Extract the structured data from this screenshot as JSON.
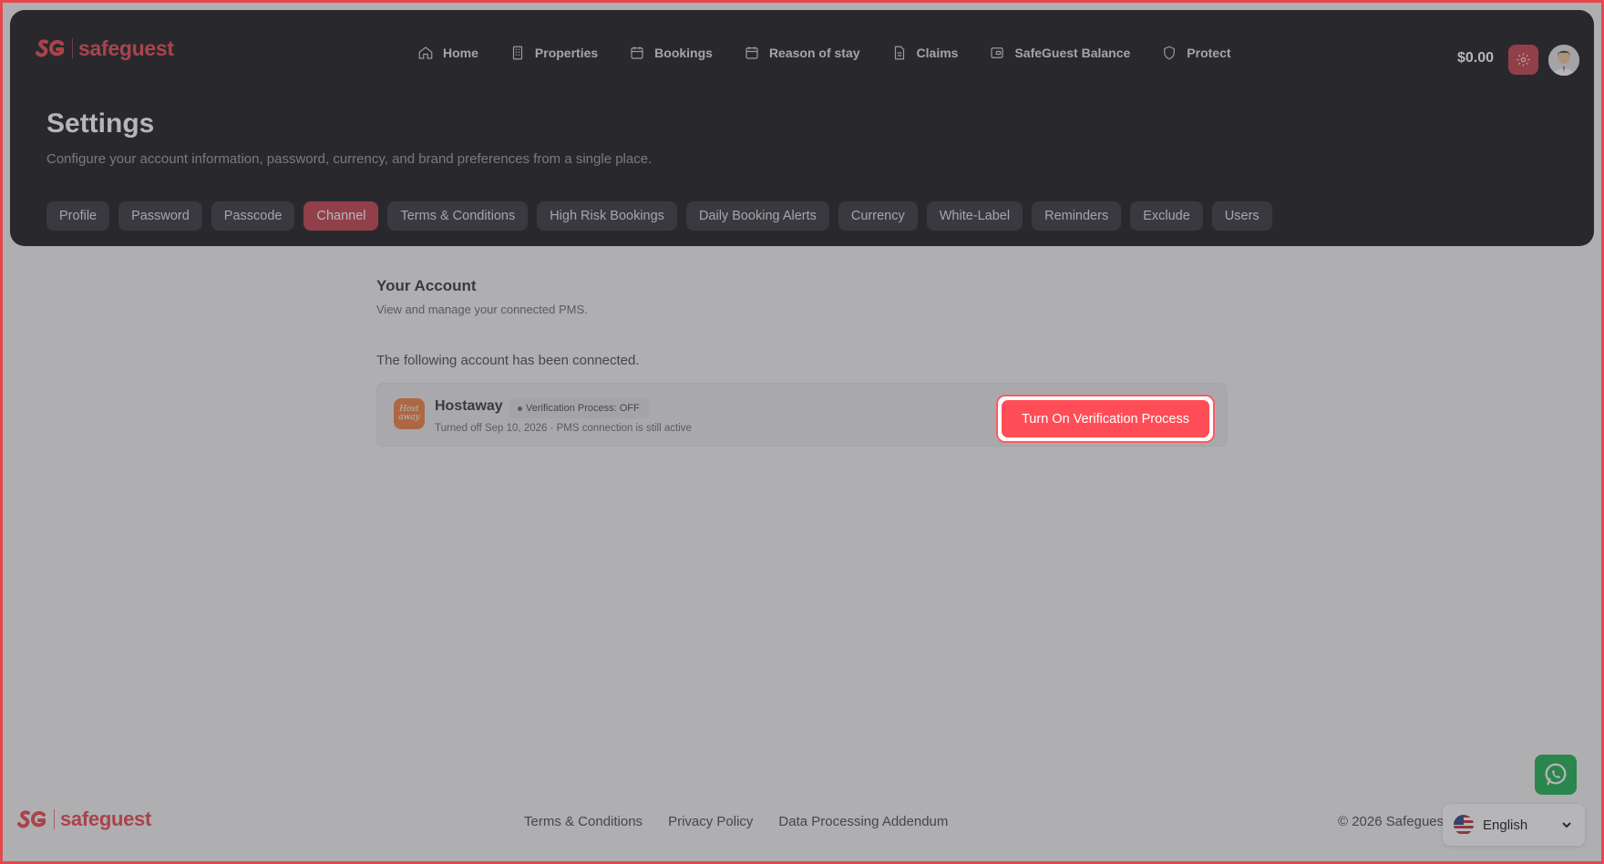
{
  "brand": {
    "name": "safeguest",
    "color": "#ef4f5a"
  },
  "nav": [
    {
      "label": "Home",
      "icon": "home-icon"
    },
    {
      "label": "Properties",
      "icon": "building-icon"
    },
    {
      "label": "Bookings",
      "icon": "calendar-icon"
    },
    {
      "label": "Reason of stay",
      "icon": "calendar-icon"
    },
    {
      "label": "Claims",
      "icon": "document-icon"
    },
    {
      "label": "SafeGuest Balance",
      "icon": "wallet-icon"
    },
    {
      "label": "Protect",
      "icon": "shield-icon"
    }
  ],
  "header": {
    "balance": "$0.00"
  },
  "page": {
    "title": "Settings",
    "subtitle": "Configure your account information, password, currency, and brand preferences from a single place."
  },
  "tabs": [
    {
      "label": "Profile",
      "active": false
    },
    {
      "label": "Password",
      "active": false
    },
    {
      "label": "Passcode",
      "active": false
    },
    {
      "label": "Channel",
      "active": true
    },
    {
      "label": "Terms & Conditions",
      "active": false
    },
    {
      "label": "High Risk Bookings",
      "active": false
    },
    {
      "label": "Daily Booking Alerts",
      "active": false
    },
    {
      "label": "Currency",
      "active": false
    },
    {
      "label": "White-Label",
      "active": false
    },
    {
      "label": "Reminders",
      "active": false
    },
    {
      "label": "Exclude",
      "active": false
    },
    {
      "label": "Users",
      "active": false
    }
  ],
  "account": {
    "title": "Your Account",
    "subtitle": "View and manage your connected PMS.",
    "connected_text": "The following account has been connected.",
    "pms": {
      "name": "Hostaway",
      "logo_text": "Host away",
      "badge": "Verification Process: OFF",
      "meta": "Turned off Sep 10, 2026 · PMS connection is still active",
      "action_label": "Turn On Verification Process"
    }
  },
  "footer": {
    "links": [
      "Terms & Conditions",
      "Privacy Policy",
      "Data Processing Addendum"
    ],
    "copyright": "© 2026 Safeguest"
  },
  "language": {
    "selected": "English"
  },
  "colors": {
    "accent": "#ff4d57",
    "active_tab": "#c74a55",
    "header_bg": "#27272a",
    "whatsapp": "#29b55a"
  }
}
